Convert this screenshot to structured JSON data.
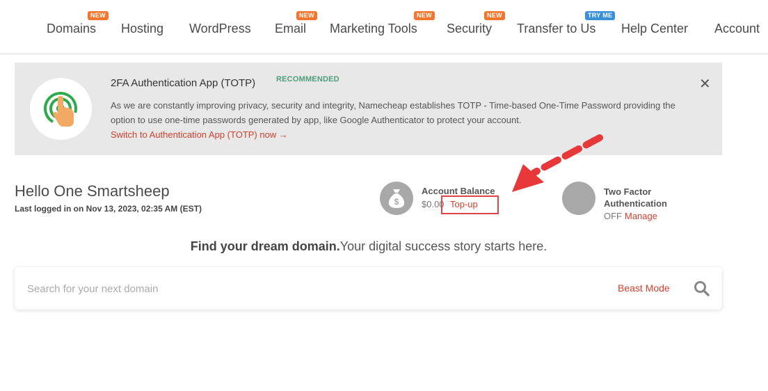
{
  "nav": {
    "items": [
      {
        "label": "Domains",
        "badge": "NEW"
      },
      {
        "label": "Hosting"
      },
      {
        "label": "WordPress"
      },
      {
        "label": "Email",
        "badge": "NEW"
      },
      {
        "label": "Marketing Tools",
        "badge": "NEW"
      },
      {
        "label": "Security",
        "badge": "NEW"
      },
      {
        "label": "Transfer to Us",
        "badge": "TRY ME"
      },
      {
        "label": "Help Center"
      },
      {
        "label": "Account"
      }
    ]
  },
  "banner": {
    "title": "2FA Authentication App (TOTP)",
    "tag": "RECOMMENDED",
    "text": "As we are constantly improving privacy, security and integrity, Namecheap establishes TOTP - Time-based One-Time Password providing the option to use one-time passwords generated by app, like Google Authenticator to protect your account.",
    "link": "Switch to Authentication App (TOTP) now →",
    "close": "✕"
  },
  "greeting": {
    "hello": "Hello One Smartsheep",
    "last_login": "Last logged in on Nov 13, 2023, 02:35 AM (EST)"
  },
  "balance": {
    "title": "Account Balance",
    "amount": "$0.00",
    "topup": "Top-up"
  },
  "tfa": {
    "title": "Two Factor Authentication",
    "status": "OFF",
    "manage": "Manage"
  },
  "tagline": {
    "bold": "Find your dream domain.",
    "rest": "Your digital success story starts here."
  },
  "search": {
    "placeholder": "Search for your next domain",
    "beast_mode": "Beast Mode"
  },
  "icons": {
    "banner": "touch-icon",
    "balance": "money-bag-icon",
    "tfa": "shield-icon",
    "search": "search-icon"
  },
  "colors": {
    "accent": "#d0402c",
    "badge_new": "#f2762e",
    "badge_try": "#3a8fd9",
    "annotation": "#e8393a"
  }
}
